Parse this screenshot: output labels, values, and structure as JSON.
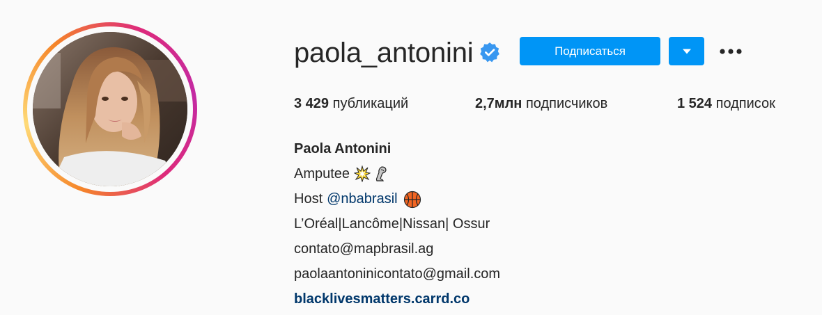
{
  "profile": {
    "username": "paola_antonini",
    "verified": true,
    "follow_label": "Подписаться",
    "dropdown_icon": "chevron-down-icon",
    "more_icon": "more-options-icon"
  },
  "stats": {
    "posts_count": "3 429",
    "posts_label": "публикаций",
    "followers_count": "2,7млн",
    "followers_label": "подписчиков",
    "following_count": "1 524",
    "following_label": "подписок"
  },
  "bio": {
    "full_name": "Paola Antonini",
    "line1": "Amputee",
    "line1_icons": [
      "collision-emoji",
      "leg-emoji"
    ],
    "line2_prefix": "Host",
    "line2_mention": "@nbabrasil",
    "line2_icon": "basketball-emoji",
    "line3": "L’Oréal|Lancôme|Nissan| Ossur",
    "line4": "contato@mapbrasil.ag",
    "line5": "paolaantoninicontato@gmail.com",
    "link": "blacklivesmatters.carrd.co"
  },
  "colors": {
    "accent": "#0095f6",
    "link": "#00376b",
    "verified": "#3897f0",
    "text": "#262626",
    "background": "#fafafa"
  }
}
